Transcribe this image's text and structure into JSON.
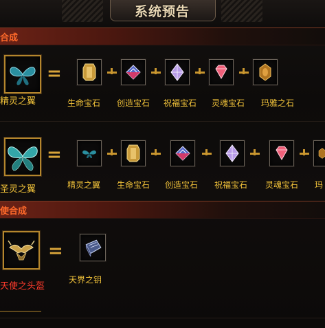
{
  "header": {
    "title": "系统预告"
  },
  "sections": {
    "s1": {
      "title": "合成"
    },
    "s2": {
      "title": "使合成"
    }
  },
  "rows": {
    "r1": {
      "result": "精灵之翼",
      "items": [
        "生命宝石",
        "创造宝石",
        "祝福宝石",
        "灵魂宝石",
        "玛雅之石"
      ]
    },
    "r2": {
      "result": "圣灵之翼",
      "items": [
        "精灵之翼",
        "生命宝石",
        "创造宝石",
        "祝福宝石",
        "灵魂宝石",
        "玛"
      ]
    },
    "r3": {
      "result": "天使之头盔",
      "items": [
        "天界之钥"
      ]
    }
  },
  "colors": {
    "gold": "#f2c33a",
    "red": "#ff3b2c",
    "orange": "#ff6a2a",
    "frame": "#b4862d"
  }
}
